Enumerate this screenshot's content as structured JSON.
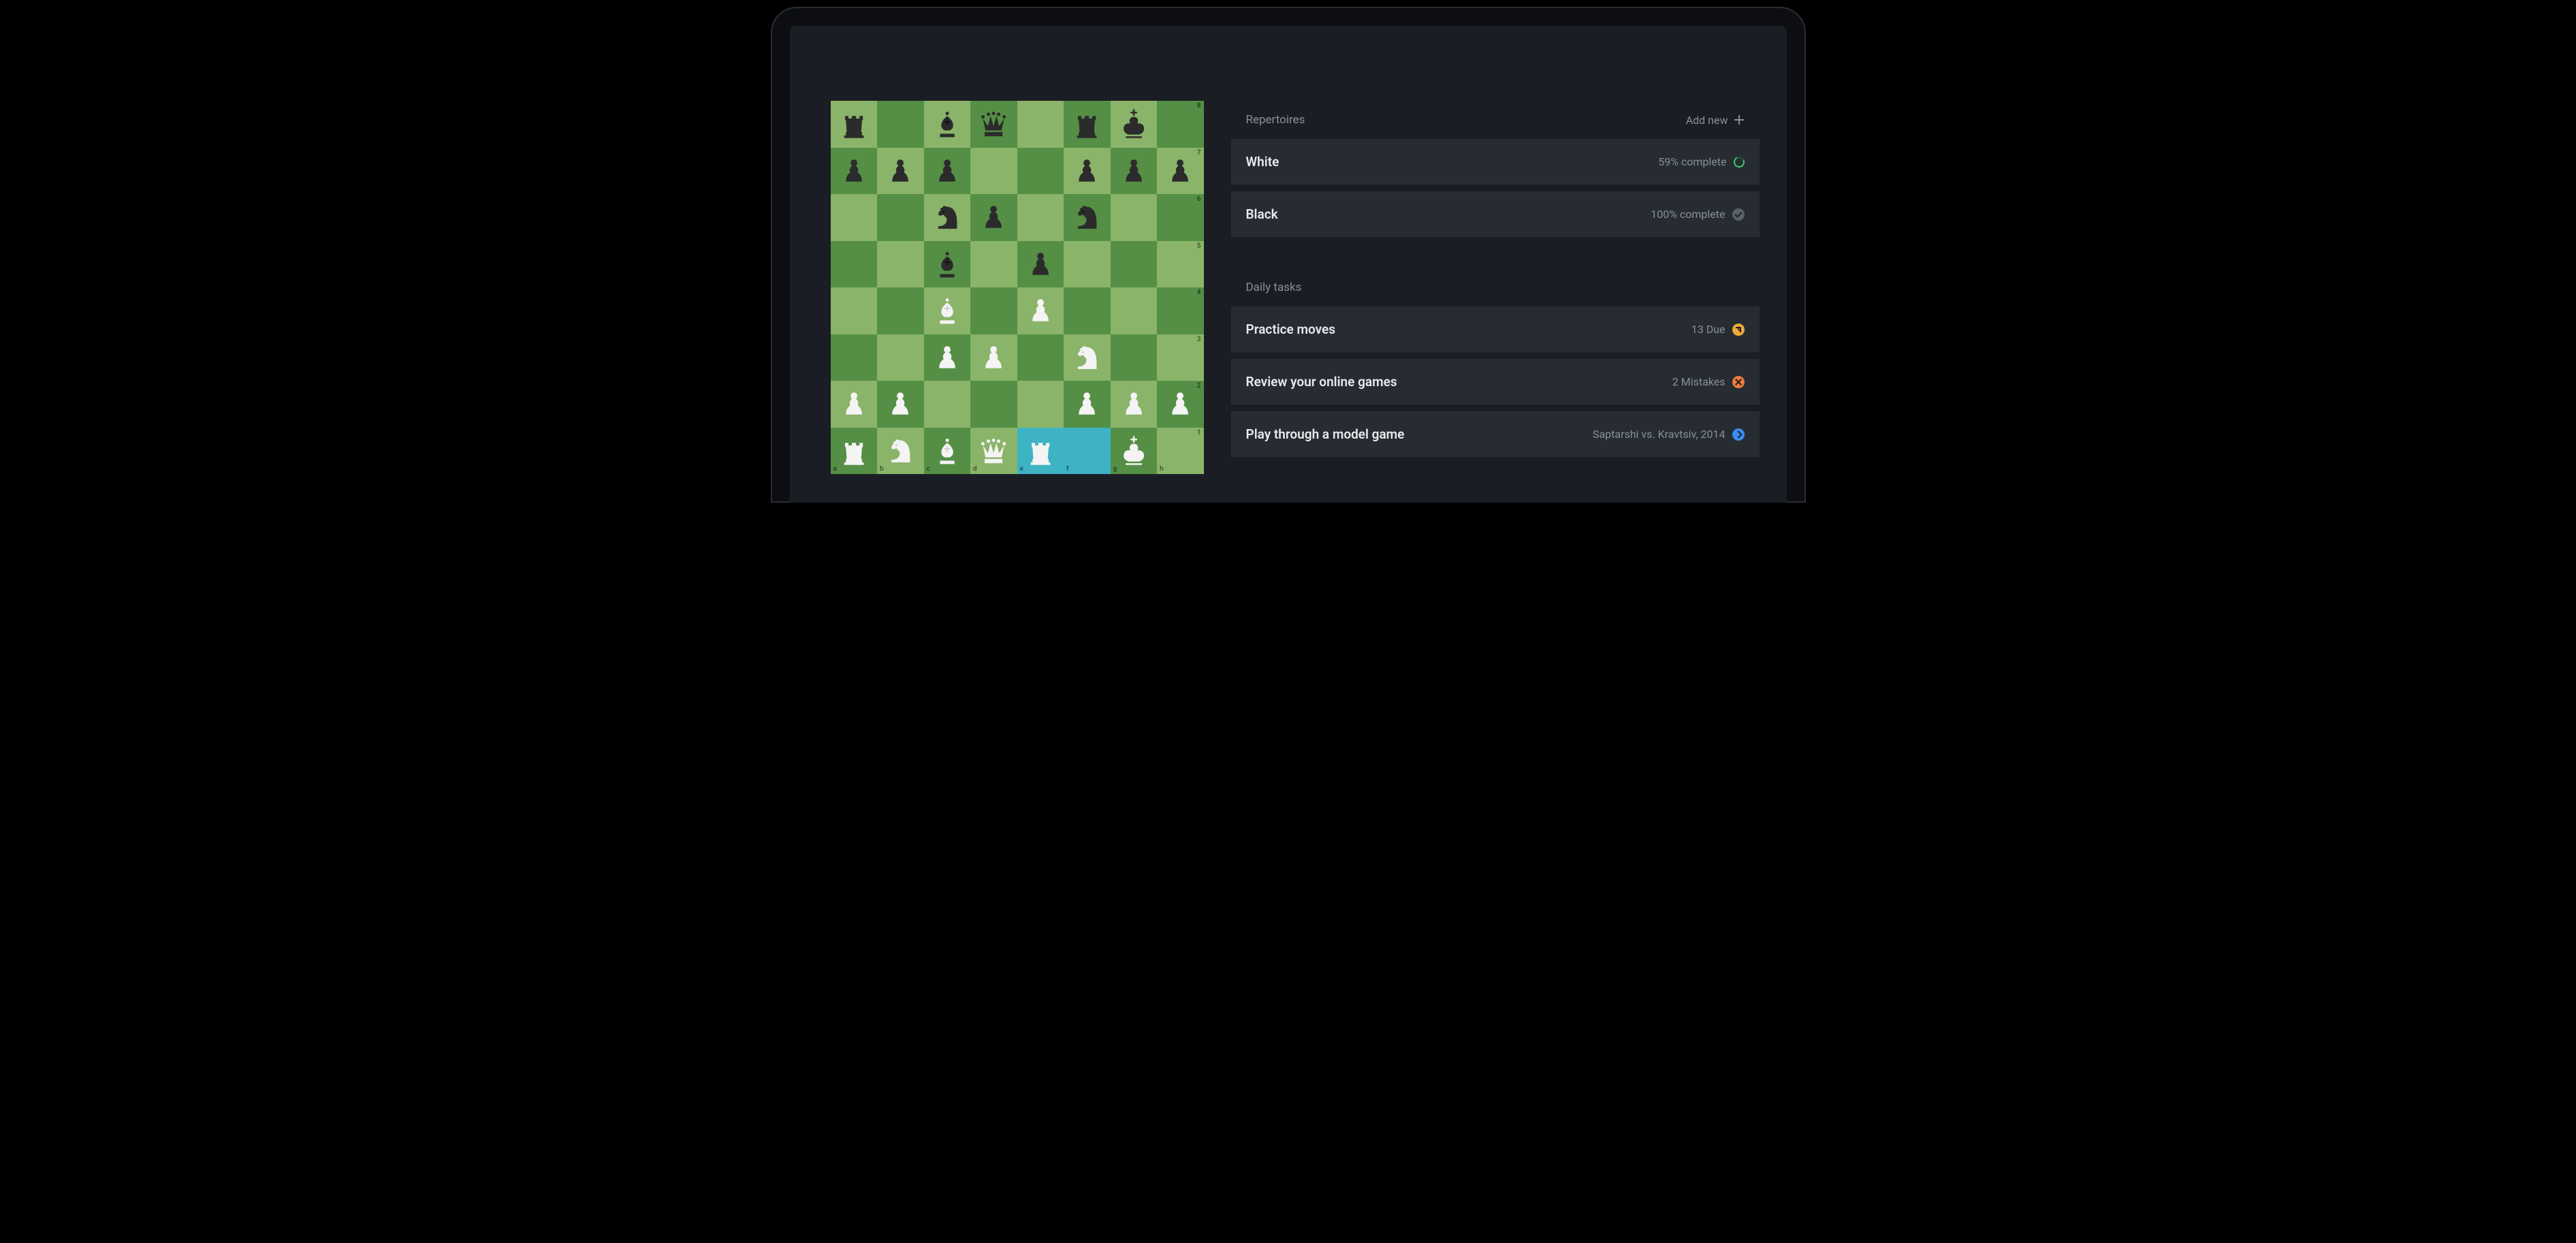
{
  "board": {
    "files": [
      "a",
      "b",
      "c",
      "d",
      "e",
      "f",
      "g",
      "h"
    ],
    "ranks": [
      "8",
      "7",
      "6",
      "5",
      "4",
      "3",
      "2",
      "1"
    ],
    "highlighted_squares": [
      "e1",
      "f1"
    ],
    "position": {
      "a8": "bR",
      "c8": "bB",
      "d8": "bQ",
      "f8": "bR",
      "g8": "bK",
      "a7": "bP",
      "b7": "bP",
      "c7": "bP",
      "f7": "bP",
      "g7": "bP",
      "h7": "bP",
      "c6": "bN",
      "d6": "bP",
      "f6": "bN",
      "c5": "bB",
      "e5": "bP",
      "c4": "wB",
      "e4": "wP",
      "c3": "wP",
      "d3": "wP",
      "f3": "wN",
      "a2": "wP",
      "b2": "wP",
      "f2": "wP",
      "g2": "wP",
      "h2": "wP",
      "a1": "wR",
      "b1": "wN",
      "c1": "wB",
      "d1": "wQ",
      "e1": "wR",
      "g1": "wK"
    }
  },
  "repertoires": {
    "heading": "Repertoires",
    "add_new_label": "Add new",
    "items": [
      {
        "name": "White",
        "status_text": "59% complete",
        "status_icon": "progress-ring-green"
      },
      {
        "name": "Black",
        "status_text": "100% complete",
        "status_icon": "check-gray"
      }
    ]
  },
  "daily_tasks": {
    "heading": "Daily tasks",
    "items": [
      {
        "name": "Practice moves",
        "status_text": "13 Due",
        "status_icon": "clock-amber"
      },
      {
        "name": "Review your online games",
        "status_text": "2 Mistakes",
        "status_icon": "x-orange"
      },
      {
        "name": "Play through a model game",
        "status_text": "Saptarshi vs. Kravtsiv, 2014",
        "status_icon": "arrow-blue"
      }
    ]
  }
}
